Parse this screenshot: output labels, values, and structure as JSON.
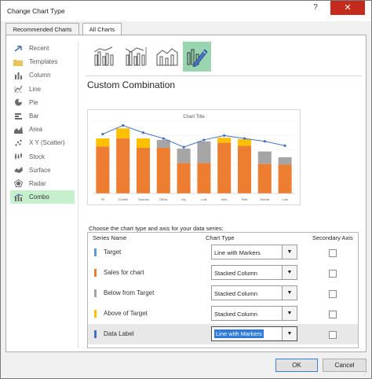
{
  "window": {
    "title": "Change Chart Type",
    "help": "?",
    "close": "✕"
  },
  "tabs": [
    {
      "label": "Recommended Charts"
    },
    {
      "label": "All Charts"
    }
  ],
  "sidebar": {
    "items": [
      {
        "label": "Recent",
        "icon": "recent-icon"
      },
      {
        "label": "Templates",
        "icon": "folder-icon"
      },
      {
        "label": "Column",
        "icon": "column-chart-icon"
      },
      {
        "label": "Line",
        "icon": "line-chart-icon"
      },
      {
        "label": "Pie",
        "icon": "pie-chart-icon"
      },
      {
        "label": "Bar",
        "icon": "bar-chart-icon"
      },
      {
        "label": "Area",
        "icon": "area-chart-icon"
      },
      {
        "label": "X Y (Scatter)",
        "icon": "scatter-chart-icon"
      },
      {
        "label": "Stock",
        "icon": "stock-chart-icon"
      },
      {
        "label": "Surface",
        "icon": "surface-chart-icon"
      },
      {
        "label": "Radar",
        "icon": "radar-chart-icon"
      },
      {
        "label": "Combo",
        "icon": "combo-chart-icon",
        "selected": true
      }
    ]
  },
  "combo_types": [
    {
      "icon": "clustered-column-line-icon"
    },
    {
      "icon": "clustered-column-line-secondary-icon"
    },
    {
      "icon": "stacked-area-column-icon"
    },
    {
      "icon": "custom-combination-icon",
      "selected": true
    }
  ],
  "main": {
    "section_title": "Custom Combination"
  },
  "chart_data": {
    "type": "bar",
    "title": "Chart Title",
    "categories": [
      "Fil",
      "Charlie",
      "Thomas",
      "Olivia",
      "Lily",
      "Luis",
      "Alex",
      "Rob",
      "Emma",
      "Lola"
    ],
    "series": [
      {
        "name": "Sales for chart",
        "values": [
          65,
          76,
          63,
          63,
          42,
          42,
          70,
          66,
          41,
          40
        ]
      },
      {
        "name": "Below from Target",
        "values": [
          0,
          0,
          0,
          11,
          20,
          30,
          0,
          0,
          17,
          10
        ]
      },
      {
        "name": "Above of Target",
        "values": [
          11,
          14,
          13,
          0,
          0,
          0,
          7,
          9,
          0,
          0
        ]
      },
      {
        "name": "Target",
        "values": [
          82,
          94,
          84,
          76,
          64,
          74,
          80,
          76,
          72,
          66
        ]
      }
    ],
    "ylim": [
      0,
      100
    ],
    "colors": {
      "Sales for chart": "#ed7d31",
      "Below from Target": "#a5a5a5",
      "Above of Target": "#ffc000",
      "Target": "#4472c4"
    }
  },
  "series_section": {
    "prompt": "Choose the chart type and axis for your data series:",
    "headers": {
      "name": "Series Name",
      "type": "Chart Type",
      "axis": "Secondary Axis"
    },
    "rows": [
      {
        "name": "Target",
        "color": "#5b9bd5",
        "type": "Line with Markers",
        "secondary": false
      },
      {
        "name": "Sales for chart",
        "color": "#ed7d31",
        "type": "Stacked Column",
        "secondary": false
      },
      {
        "name": "Below from Target",
        "color": "#a5a5a5",
        "type": "Stacked Column",
        "secondary": false
      },
      {
        "name": "Above of Target",
        "color": "#ffc000",
        "type": "Stacked Column",
        "secondary": false
      },
      {
        "name": "Data Label",
        "color": "#4472c4",
        "type": "Line with Markers",
        "secondary": false,
        "selected": true
      }
    ]
  },
  "buttons": {
    "ok": "OK",
    "cancel": "Cancel"
  }
}
